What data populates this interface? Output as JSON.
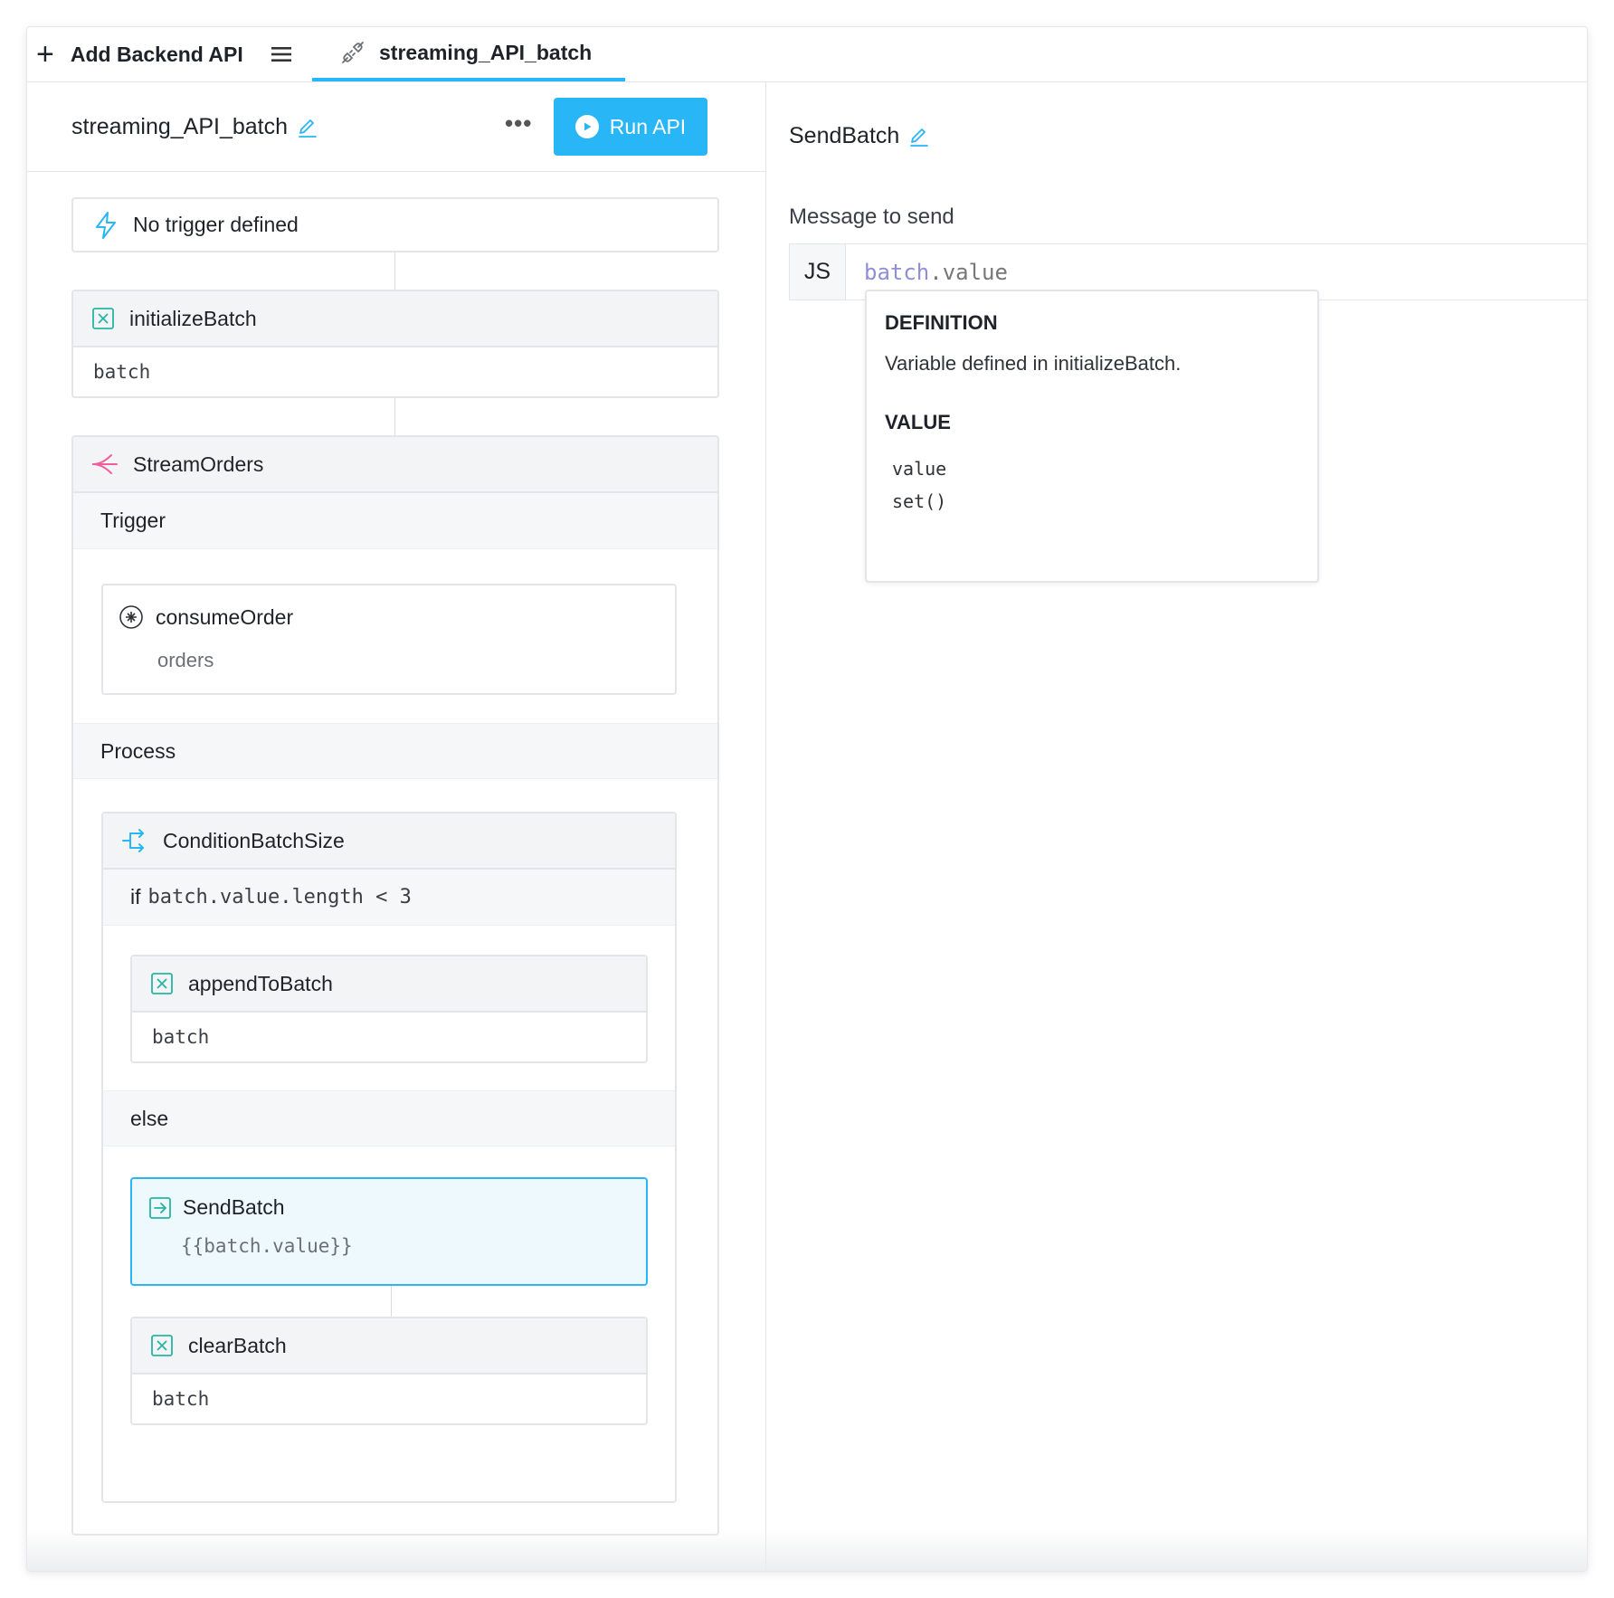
{
  "tabbar": {
    "add_label": "Add Backend API",
    "menu_icon": "hamburger-menu-icon",
    "active_tab_label": "streaming_API_batch"
  },
  "left": {
    "api_name": "streaming_API_batch",
    "more_label": "•••",
    "run_label": "Run API",
    "trigger": {
      "label": "No trigger defined"
    },
    "initialize": {
      "title": "initializeBatch",
      "body": "batch"
    },
    "stream": {
      "title": "StreamOrders",
      "trigger_section": "Trigger",
      "consume": {
        "title": "consumeOrder",
        "subtitle": "orders"
      },
      "process_section": "Process",
      "condition": {
        "title": "ConditionBatchSize",
        "if_keyword": "if",
        "if_expr": "batch.value.length < 3",
        "append": {
          "title": "appendToBatch",
          "body": "batch"
        },
        "else_label": "else",
        "send": {
          "title": "SendBatch",
          "body": "{{batch.value}}"
        },
        "clear": {
          "title": "clearBatch",
          "body": "batch"
        }
      }
    }
  },
  "right": {
    "step_title": "SendBatch",
    "message_label": "Message to send",
    "js_tag": "JS",
    "code_var": "batch",
    "code_rest": ".value",
    "tooltip": {
      "definition_heading": "DEFINITION",
      "definition_text": "Variable defined in initializeBatch.",
      "value_heading": "VALUE",
      "value_line1": "value",
      "value_line2": "set()"
    }
  },
  "colors": {
    "accent": "#29b6f6",
    "variable_green": "#26b5a3",
    "stream_pink": "#f25c9a",
    "code_var": "#8f8ed6"
  }
}
